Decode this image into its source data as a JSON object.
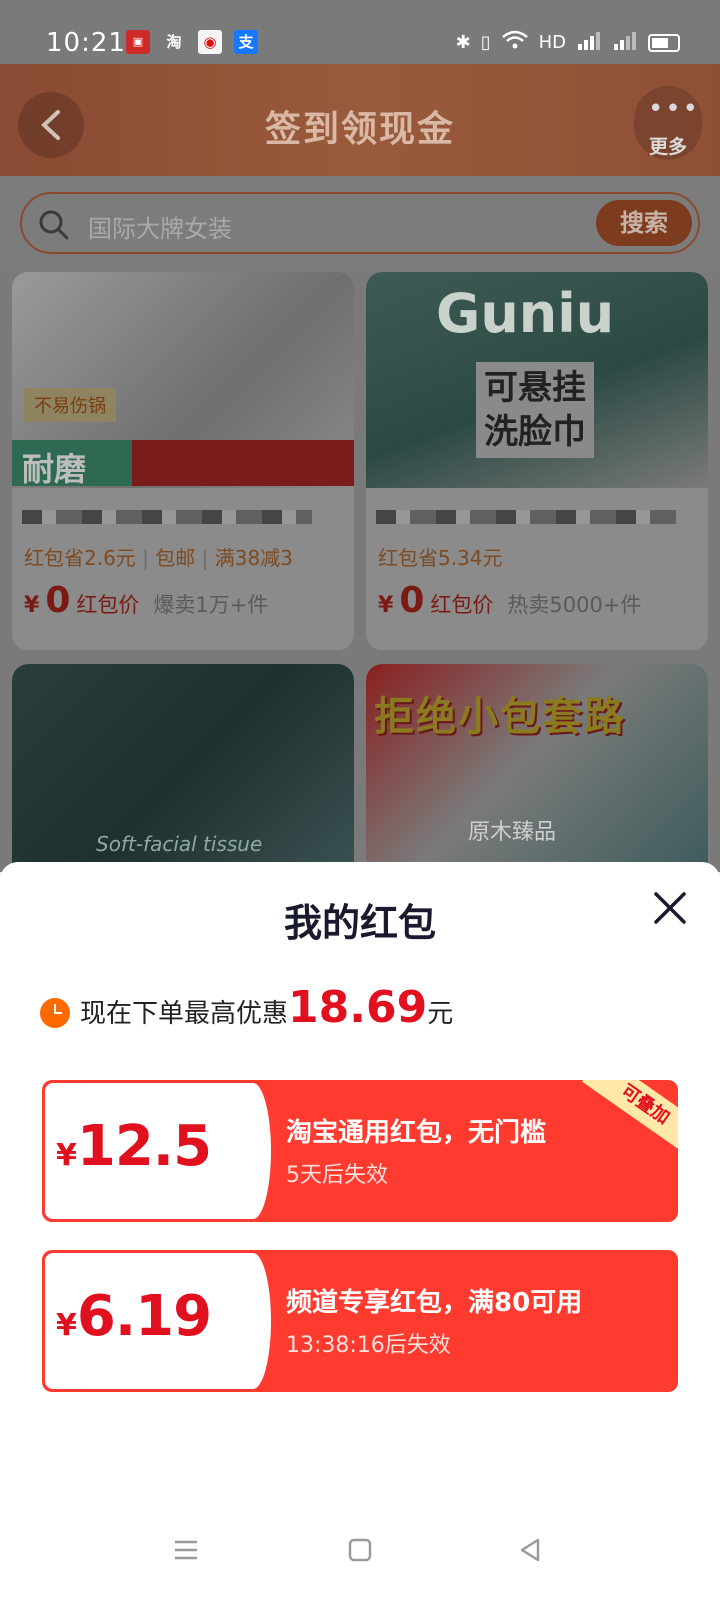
{
  "status_bar": {
    "time": "10:21",
    "apps": [
      {
        "icon": "app-icon-1",
        "glyph": "卍",
        "bg": "#cf2a2a",
        "color": "#fff"
      },
      {
        "icon": "taobao-icon",
        "glyph": "淘",
        "bg": "#7a7a7a",
        "color": "#fff"
      },
      {
        "icon": "map-pin-app-icon",
        "glyph": "◉",
        "bg": "#f5f5f5",
        "color": "#d11"
      },
      {
        "icon": "alipay-icon",
        "glyph": "支",
        "bg": "#1677ff",
        "color": "#fff"
      }
    ],
    "right_text": "HD"
  },
  "header": {
    "title": "签到领现金",
    "more_label": "更多"
  },
  "search": {
    "placeholder": "国际大牌女装",
    "button_label": "搜索"
  },
  "products": [
    {
      "badge": "不易伤锅",
      "banner": "耐磨",
      "meta": [
        "红包省2.6元",
        "包邮",
        "满38减3"
      ],
      "yen": "¥",
      "price": "0",
      "price_label": "红包价",
      "sales": "爆卖1万+件"
    },
    {
      "brand": "Guniu",
      "overlay": "可悬挂\n洗脸巾",
      "meta": [
        "红包省5.34元"
      ],
      "yen": "¥",
      "price": "0",
      "price_label": "红包价",
      "sales": "热卖5000+件"
    },
    {
      "overlay": "Soft-facial tissue"
    },
    {
      "headline": "拒绝小包套路",
      "overlay": "原木臻品"
    }
  ],
  "sheet": {
    "title": "我的红包",
    "summary_lead": "现在下单最高优惠",
    "summary_amount": "18.69",
    "summary_unit": "元",
    "coupons": [
      {
        "currency": "¥",
        "amount": "12.5",
        "name": "淘宝通用红包，无门槛",
        "expiry": "5天后失效",
        "badge": "可叠加"
      },
      {
        "currency": "¥",
        "amount": "6.19",
        "name": "频道专享红包，满80可用",
        "expiry": "13:38:16后失效"
      }
    ]
  },
  "colors": {
    "accent_red": "#e0101e",
    "coupon_red": "#ff3b30",
    "clock_orange": "#ff6a00"
  }
}
